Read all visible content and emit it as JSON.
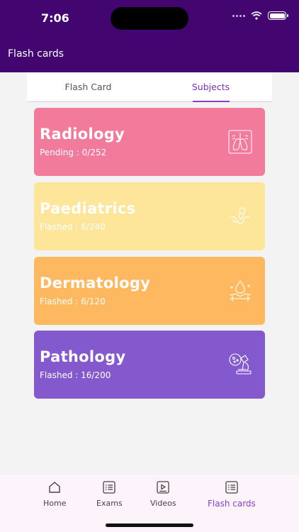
{
  "status_bar": {
    "time": "7:06"
  },
  "header": {
    "title": "Flash cards"
  },
  "tabs": [
    {
      "label": "Flash Card"
    },
    {
      "label": "Subjects"
    }
  ],
  "subjects": [
    {
      "name": "Radiology",
      "status": "Pending : 0/252",
      "icon": "lungs-icon",
      "color": "#f27a9b"
    },
    {
      "name": "Paediatrics",
      "status": "Flashed : 6/240",
      "icon": "baby-hands-icon",
      "color": "#fde699"
    },
    {
      "name": "Dermatology",
      "status": "Flashed : 6/120",
      "icon": "skin-droplet-icon",
      "color": "#feb85f"
    },
    {
      "name": "Pathology",
      "status": "Flashed : 16/200",
      "icon": "microscope-icon",
      "color": "#8559ce"
    }
  ],
  "bottom_nav": [
    {
      "label": "Home",
      "icon": "home-icon"
    },
    {
      "label": "Exams",
      "icon": "exams-icon"
    },
    {
      "label": "Videos",
      "icon": "video-icon"
    },
    {
      "label": "Flash cards",
      "icon": "flashcards-icon"
    }
  ],
  "colors": {
    "header": "#43056f",
    "accent": "#8a3fd0"
  }
}
